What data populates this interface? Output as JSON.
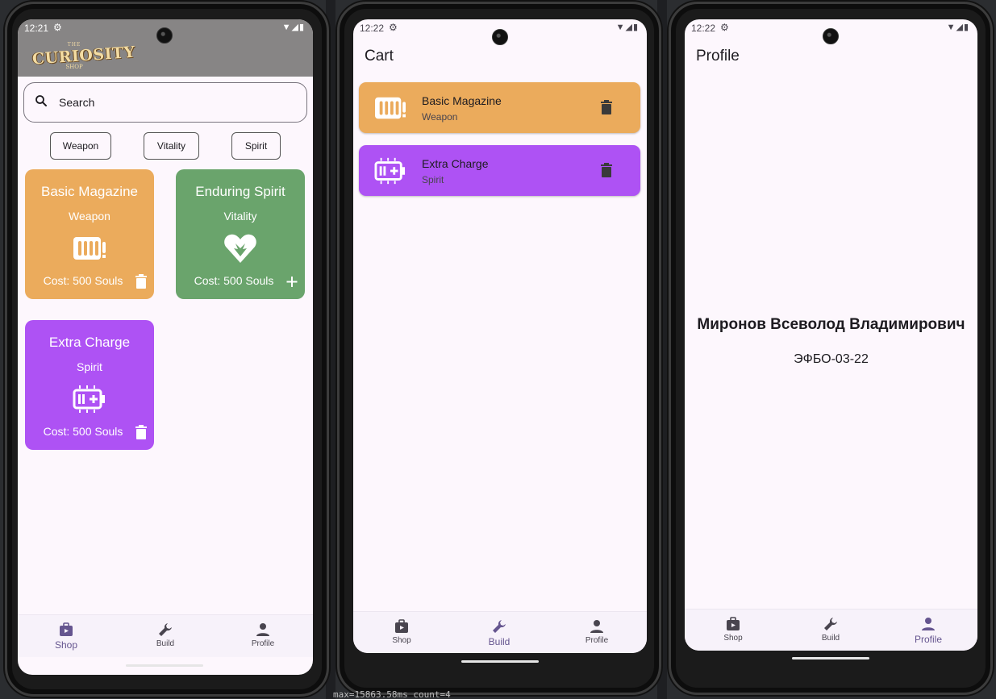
{
  "colors": {
    "weapon": "#ebab5c",
    "vitality": "#6aa46c",
    "spirit": "#ae52f4",
    "active_nav": "#65558f"
  },
  "phones": [
    {
      "status": {
        "time": "12:21"
      },
      "logo": {
        "top": "THE",
        "main": "CURIOSITY",
        "bottom": "SHOP"
      },
      "search": {
        "placeholder": "Search",
        "icon": "search-icon"
      },
      "filters": [
        "Weapon",
        "Vitality",
        "Spirit"
      ],
      "cards": [
        {
          "title": "Basic Magazine",
          "category": "Weapon",
          "cost": "Cost: 500 Souls",
          "icon": "ammo-icon",
          "action": "delete-icon"
        },
        {
          "title": "Enduring Spirit",
          "category": "Vitality",
          "cost": "Cost: 500 Souls",
          "icon": "heart-spirit-icon",
          "action": "add-icon"
        },
        {
          "title": "Extra Charge",
          "category": "Spirit",
          "cost": "Cost: 500 Souls",
          "icon": "battery-icon",
          "action": "delete-icon"
        }
      ],
      "nav": {
        "shop": "Shop",
        "build": "Build",
        "profile": "Profile",
        "active": "shop"
      }
    },
    {
      "status": {
        "time": "12:22"
      },
      "title": "Cart",
      "cart": [
        {
          "name": "Basic Magazine",
          "category": "Weapon",
          "icon": "ammo-icon"
        },
        {
          "name": "Extra Charge",
          "category": "Spirit",
          "icon": "battery-icon"
        }
      ],
      "nav": {
        "shop": "Shop",
        "build": "Build",
        "profile": "Profile",
        "active": "build"
      }
    },
    {
      "status": {
        "time": "12:22"
      },
      "title": "Profile",
      "name": "Миронов Всеволод Владимирович",
      "group": "ЭФБО-03-22",
      "nav": {
        "shop": "Shop",
        "build": "Build",
        "profile": "Profile",
        "active": "profile"
      }
    }
  ],
  "debug_overlay": "max=15863.58ms count=4"
}
